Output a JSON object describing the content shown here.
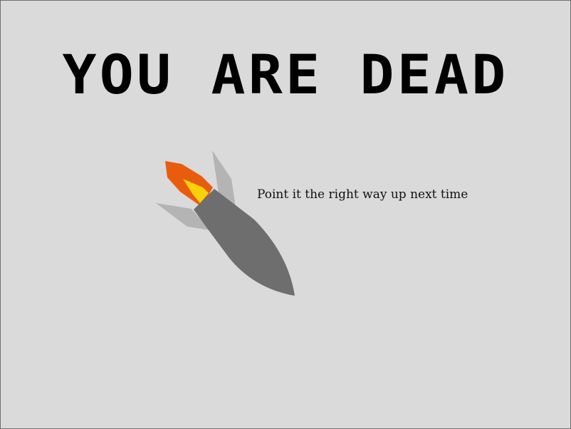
{
  "game": {
    "title": "YOU ARE DEAD",
    "message": "Point it the right way up next time"
  },
  "colors": {
    "background": "#dadada",
    "title": "#000000",
    "rocket_body": "#6e6e6e",
    "rocket_fins": "#b4b4b4",
    "flame_outer": "#e85c0d",
    "flame_inner": "#f7d10b"
  },
  "icons": {
    "rocket": "crashed-rocket-icon"
  }
}
